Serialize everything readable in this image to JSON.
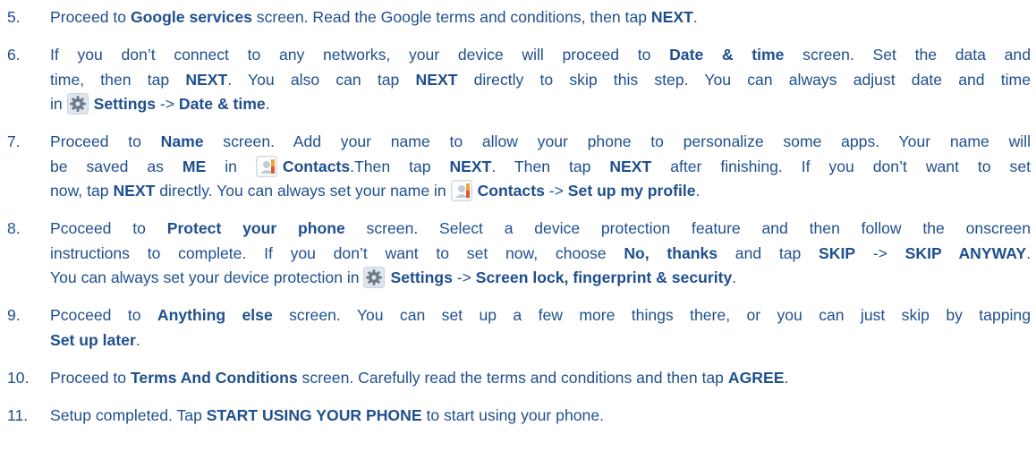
{
  "steps": [
    {
      "num": "5.",
      "lines": [
        [
          {
            "t": "Proceed to "
          },
          {
            "t": "Google services",
            "b": true
          },
          {
            "t": " screen. Read the Google terms and conditions, then tap "
          },
          {
            "t": "NEXT",
            "b": true
          },
          {
            "t": "."
          }
        ]
      ]
    },
    {
      "num": "6.",
      "lines": [
        [
          {
            "t": "If you don’t connect to any networks, your device will proceed to "
          },
          {
            "t": "Date & time",
            "b": true
          },
          {
            "t": " screen. Set the data and"
          }
        ],
        [
          {
            "t": "time, then tap "
          },
          {
            "t": "NEXT",
            "b": true
          },
          {
            "t": ". You also can tap "
          },
          {
            "t": "NEXT",
            "b": true
          },
          {
            "t": " directly to skip this step. You can always adjust date and time"
          }
        ],
        [
          {
            "t": "in "
          },
          {
            "icon": "settings-icon"
          },
          {
            "t": "Settings",
            "b": true
          },
          {
            "t": " -> "
          },
          {
            "t": "Date & time",
            "b": true
          },
          {
            "t": "."
          }
        ]
      ]
    },
    {
      "num": "7.",
      "lines": [
        [
          {
            "t": "Proceed to "
          },
          {
            "t": "Name",
            "b": true
          },
          {
            "t": " screen. Add your name to allow your phone to personalize some apps. Your name will"
          }
        ],
        [
          {
            "t": "be saved as "
          },
          {
            "t": "ME",
            "b": true
          },
          {
            "t": " in "
          },
          {
            "icon": "contacts-icon"
          },
          {
            "t": "Contacts",
            "b": true
          },
          {
            "t": ".Then tap "
          },
          {
            "t": "NEXT",
            "b": true
          },
          {
            "t": ". Then tap "
          },
          {
            "t": "NEXT",
            "b": true
          },
          {
            "t": " after finishing. If you don’t want to set"
          }
        ],
        [
          {
            "t": "now, tap "
          },
          {
            "t": "NEXT",
            "b": true
          },
          {
            "t": " directly. You can always set your name in "
          },
          {
            "icon": "contacts-icon"
          },
          {
            "t": "Contacts",
            "b": true
          },
          {
            "t": " -> "
          },
          {
            "t": "Set up my profile",
            "b": true
          },
          {
            "t": "."
          }
        ]
      ]
    },
    {
      "num": "8.",
      "lines": [
        [
          {
            "t": "Pcoceed to "
          },
          {
            "t": "Protect your phone",
            "b": true
          },
          {
            "t": " screen. Select a device protection feature and then follow the onscreen"
          }
        ],
        [
          {
            "t": "instructions to complete. If you don’t want to set now, choose "
          },
          {
            "t": "No, thanks",
            "b": true
          },
          {
            "t": " and tap "
          },
          {
            "t": "SKIP",
            "b": true
          },
          {
            "t": " -> "
          },
          {
            "t": "SKIP ANYWAY",
            "b": true
          },
          {
            "t": "."
          }
        ],
        [
          {
            "t": "You can always set your device protection in "
          },
          {
            "icon": "settings-icon"
          },
          {
            "t": "Settings",
            "b": true
          },
          {
            "t": " -> "
          },
          {
            "t": "Screen lock, fingerprint & security",
            "b": true
          },
          {
            "t": "."
          }
        ]
      ]
    },
    {
      "num": "9.",
      "lines": [
        [
          {
            "t": "Pcoceed to "
          },
          {
            "t": "Anything else",
            "b": true
          },
          {
            "t": " screen. You can set up a few more things there, or you can just skip by tapping"
          }
        ],
        [
          {
            "t": "Set up later",
            "b": true
          },
          {
            "t": "."
          }
        ]
      ]
    },
    {
      "num": "10.",
      "lines": [
        [
          {
            "t": "Proceed to "
          },
          {
            "t": "Terms And Conditions",
            "b": true
          },
          {
            "t": " screen. Carefully read the terms and conditions and then tap "
          },
          {
            "t": "AGREE",
            "b": true
          },
          {
            "t": "."
          }
        ]
      ]
    },
    {
      "num": "11.",
      "lines": [
        [
          {
            "t": "Setup completed. Tap "
          },
          {
            "t": "START USING YOUR PHONE",
            "b": true
          },
          {
            "t": " to start using your phone."
          }
        ]
      ]
    }
  ],
  "colors": {
    "text": "#1f4f8e",
    "icon_bg": "#dfe6ee",
    "icon_fg": "#6b7a88"
  }
}
